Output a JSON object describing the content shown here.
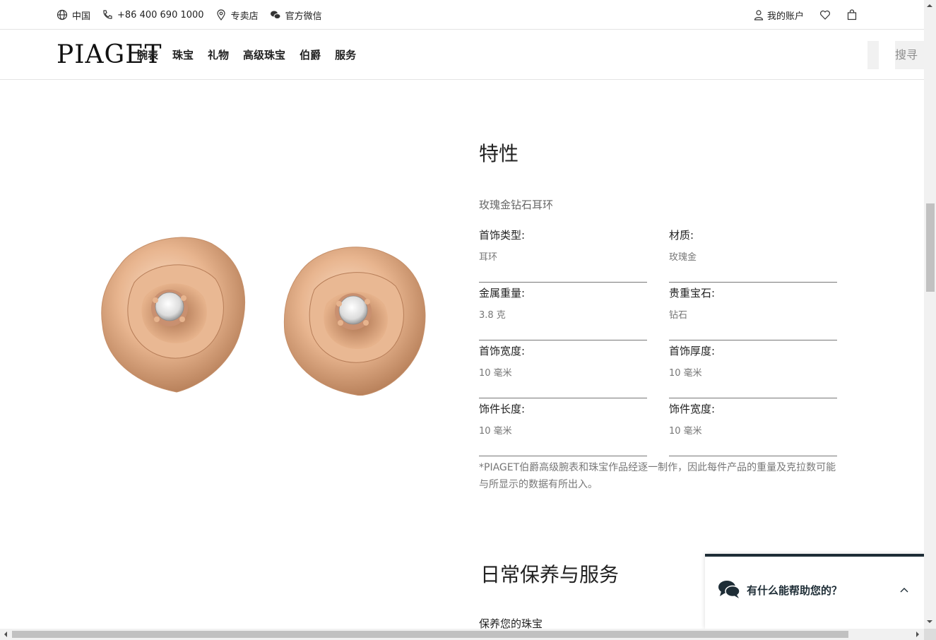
{
  "topbar": {
    "region": "中国",
    "phone": "+86 400 690 1000",
    "stores": "专卖店",
    "wechat": "官方微信",
    "account": "我的账户"
  },
  "nav": {
    "logo": "PIAGET",
    "items": [
      "腕表",
      "珠宝",
      "礼物",
      "高级珠宝",
      "伯爵",
      "服务"
    ],
    "search_label": "搜寻"
  },
  "specs": {
    "title": "特性",
    "subtitle": "玫瑰金钻石耳环",
    "rows": [
      {
        "label": "首饰类型:",
        "value": "耳环"
      },
      {
        "label": "材质:",
        "value": "玫瑰金"
      },
      {
        "label": "金属重量:",
        "value": "3.8 克"
      },
      {
        "label": "贵重宝石:",
        "value": "钻石"
      },
      {
        "label": "首饰宽度:",
        "value": "10 毫米"
      },
      {
        "label": "首饰厚度:",
        "value": "10 毫米"
      },
      {
        "label": "饰件长度:",
        "value": "10 毫米"
      },
      {
        "label": "饰件宽度:",
        "value": "10 毫米"
      }
    ],
    "note": "*PIAGET伯爵高级腕表和珠宝作品经逐一制作，因此每件产品的重量及克拉数可能与所显示的数据有所出入。"
  },
  "care": {
    "title": "日常保养与服务",
    "subtitle": "保养您的珠宝"
  },
  "chat": {
    "label": "有什么能帮助您的？"
  },
  "colors": {
    "rose_gold": "#e7b48e",
    "chat_accent": "#1e2d36"
  }
}
